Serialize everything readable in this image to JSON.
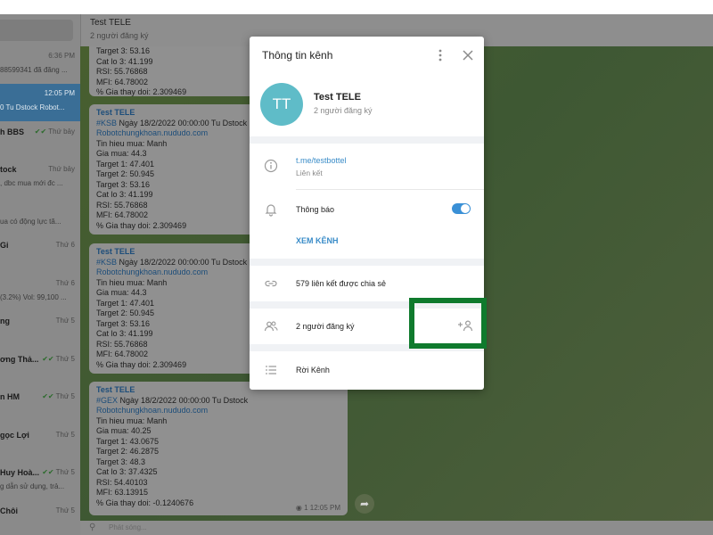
{
  "chat_header": {
    "title": "Test TELE",
    "subtitle": "2 người đăng ký"
  },
  "chat_list": [
    {
      "name": "",
      "time": "6:36 PM",
      "preview": "88599341 đã đăng ..."
    },
    {
      "name": "",
      "time": "12:05 PM",
      "preview": "0 Tu Dstock Robot..."
    },
    {
      "name": "h BBS",
      "time": "Thứ bảy",
      "preview": ""
    },
    {
      "name": "tock",
      "time": "Thứ bảy",
      "preview": ", dbc mua mới đc ..."
    },
    {
      "name": "",
      "time": "",
      "preview": "ua có động lực tă..."
    },
    {
      "name": "Gi",
      "time": "Thứ 6",
      "preview": ""
    },
    {
      "name": "",
      "time": "Thứ 6",
      "preview": "(3.2%) Vol: 99,100 ..."
    },
    {
      "name": "ng",
      "time": "Thứ 5",
      "preview": ""
    },
    {
      "name": "ơng Thả...",
      "time": "Thứ 5",
      "preview": ""
    },
    {
      "name": "n HM",
      "time": "Thứ 5",
      "preview": ""
    },
    {
      "name": "gọc Lợi",
      "time": "Thứ 5",
      "preview": ""
    },
    {
      "name": "Huy Hoà...",
      "time": "Thứ 5",
      "preview": "g dẫn sử dụng, trả..."
    },
    {
      "name": "Chôi",
      "time": "Thứ 5",
      "preview": ""
    }
  ],
  "messages": [
    {
      "title": "",
      "tag": "",
      "head": "",
      "link": "",
      "lines": [
        "Target 3: 53.16",
        "Cat lo 3: 41.199",
        "RSI: 55.76868",
        "MFI: 64.78002",
        "% Gia thay doi: 2.309469"
      ]
    },
    {
      "title": "Test TELE",
      "tag": "#KSB",
      "head": " Ngày 18/2/2022 00:00:00 Tu Dstock",
      "link": "Robotchungkhoan.nududo.com",
      "lines": [
        "Tin hieu mua: Manh",
        "Gia mua: 44.3",
        "Target 1: 47.401",
        "Target 2: 50.945",
        "Target 3: 53.16",
        "Cat lo 3: 41.199",
        "RSI: 55.76868",
        "MFI: 64.78002",
        "% Gia thay doi: 2.309469"
      ]
    },
    {
      "title": "Test TELE",
      "tag": "#KSB",
      "head": " Ngày 18/2/2022 00:00:00 Tu Dstock",
      "link": "Robotchungkhoan.nududo.com",
      "lines": [
        "Tin hieu mua: Manh",
        "Gia mua: 44.3",
        "Target 1: 47.401",
        "Target 2: 50.945",
        "Target 3: 53.16",
        "Cat lo 3: 41.199",
        "RSI: 55.76868",
        "MFI: 64.78002",
        "% Gia thay doi: 2.309469"
      ]
    },
    {
      "title": "Test TELE",
      "tag": "#GEX",
      "head": " Ngày 18/2/2022 00:00:00 Tu Dstock",
      "link": "Robotchungkhoan.nududo.com",
      "lines": [
        "Tin hieu mua: Manh",
        "Gia mua: 40.25",
        "Target 1: 43.0675",
        "Target 2: 46.2875",
        "Target 3: 48.3",
        "Cat lo 3: 37.4325",
        "RSI: 54.40103",
        "MFI: 63.13915",
        "% Gia thay doi: -0.1240676"
      ],
      "views": "1",
      "time": "12:05 PM"
    }
  ],
  "composer": {
    "placeholder": "Phát sóng..."
  },
  "modal": {
    "title": "Thông tin kênh",
    "avatar_initials": "TT",
    "avatar_color": "#5fbcc8",
    "channel_name": "Test TELE",
    "channel_sub": "2 người đăng ký",
    "link_value": "t.me/testbottel",
    "link_label": "Liên kết",
    "notifications_label": "Thông báo",
    "notifications_on": true,
    "view_channel": "XEM KÊNH",
    "shared_links": "579 liên kết được chia sẻ",
    "subscribers": "2 người đăng ký",
    "leave": "Rời Kênh"
  },
  "colors": {
    "accent": "#3a8cc8",
    "highlight": "#0f7a2d"
  }
}
